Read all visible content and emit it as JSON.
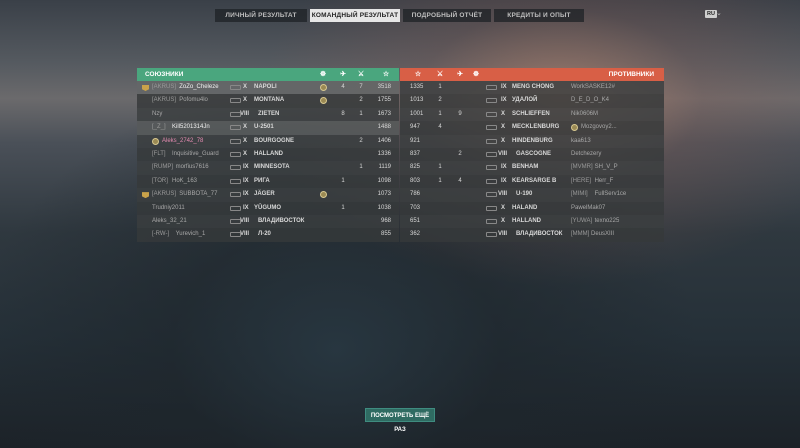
{
  "tabs": [
    "ЛИЧНЫЙ РЕЗУЛЬТАТ",
    "КОМАНДНЫЙ РЕЗУЛЬТАТ",
    "ПОДРОБНЫЙ ОТЧЁТ",
    "КРЕДИТЫ И ОПЫТ"
  ],
  "active_tab": "КОМАНДНЫЙ РЕЗУЛЬТАТ",
  "lang": "RU",
  "ally_title": "СОЮЗНИКИ",
  "enemy_title": "ПРОТИВНИКИ",
  "header_icons": {
    "ally": [
      "medal-icon",
      "planes-icon",
      "kills-icon",
      "score-star-icon"
    ],
    "enemy": [
      "score-star-icon",
      "kills-icon",
      "planes-icon",
      "medal-icon"
    ],
    "glyphs": {
      "medal-icon": "☸",
      "planes-icon": "✈",
      "kills-icon": "⚔",
      "score-star-icon": "☆"
    }
  },
  "allies": [
    {
      "clan": "[AKRUS]",
      "name": "ZoZo_Cheleze",
      "tier": "X",
      "ship": "NAPOLI",
      "medal": true,
      "planes": "4",
      "kills": "7",
      "score": "3518",
      "flag": true,
      "me": true
    },
    {
      "clan": "[AKRUS]",
      "name": "Pofomu4lo",
      "tier": "X",
      "ship": "MONTANA",
      "medal": true,
      "planes": "",
      "kills": "2",
      "score": "1755"
    },
    {
      "clan": "",
      "name": "Nzy",
      "tier": "VIII",
      "ship": "ZIETEN",
      "planes": "8",
      "kills": "1",
      "score": "1673"
    },
    {
      "clan": "[_Z_]",
      "name": "Kill5201314Jn",
      "tier": "X",
      "ship": "U-2501",
      "planes": "",
      "kills": "",
      "score": "1488",
      "sel": true,
      "white": true
    },
    {
      "clan": "",
      "name": "Aleks_2742_78",
      "tier": "X",
      "ship": "BOURGOGNE",
      "planes": "",
      "kills": "2",
      "score": "1406",
      "pink": true
    },
    {
      "clan": "[FLT]",
      "name": "Inquisitive_Guard",
      "tier": "X",
      "ship": "HALLAND",
      "planes": "",
      "kills": "",
      "score": "1336"
    },
    {
      "clan": "[RUMP]",
      "name": "morfius7616",
      "tier": "IX",
      "ship": "MINNESOTA",
      "planes": "",
      "kills": "1",
      "score": "1119"
    },
    {
      "clan": "[TOR]",
      "name": "HoK_163",
      "tier": "IX",
      "ship": "РИГА",
      "planes": "1",
      "kills": "",
      "score": "1098"
    },
    {
      "clan": "[AKRUS]",
      "name": "SUBBOTA_77",
      "tier": "IX",
      "ship": "JÄGER",
      "medal": true,
      "planes": "",
      "kills": "",
      "score": "1073",
      "flag": true
    },
    {
      "clan": "",
      "name": "Trudniy2011",
      "tier": "IX",
      "ship": "YŪGUMO",
      "planes": "1",
      "kills": "",
      "score": "1038"
    },
    {
      "clan": "",
      "name": "Aleks_32_21",
      "tier": "VIII",
      "ship": "ВЛАДИВОСТОК",
      "planes": "",
      "kills": "",
      "score": "968"
    },
    {
      "clan": "[-RW-]",
      "name": "Yurevich_1",
      "tier": "VIII",
      "ship": "Л-20",
      "planes": "",
      "kills": "",
      "score": "855"
    }
  ],
  "enemies": [
    {
      "score": "1335",
      "kills": "1",
      "planes": "",
      "tier": "IX",
      "ship": "MENG CHONG",
      "clan": "",
      "name": "WorkSASKE12#"
    },
    {
      "score": "1013",
      "kills": "2",
      "planes": "",
      "tier": "IX",
      "ship": "УДАЛОЙ",
      "clan": "",
      "name": "D_E_D_O_K4"
    },
    {
      "score": "1001",
      "kills": "1",
      "planes": "9",
      "tier": "X",
      "ship": "SCHLIEFFEN",
      "clan": "",
      "name": "Nik0606M"
    },
    {
      "score": "947",
      "kills": "4",
      "planes": "",
      "tier": "X",
      "ship": "MECKLENBURG",
      "clan": "",
      "name": "Mozgovoy2...",
      "medal": true
    },
    {
      "score": "921",
      "kills": "",
      "planes": "",
      "tier": "X",
      "ship": "HINDENBURG",
      "clan": "",
      "name": "kaa613"
    },
    {
      "score": "837",
      "kills": "",
      "planes": "2",
      "tier": "VIII",
      "ship": "GASCOGNE",
      "clan": "",
      "name": "Detchezery"
    },
    {
      "score": "825",
      "kills": "1",
      "planes": "",
      "tier": "IX",
      "ship": "BENHAM",
      "clan": "[MVMR]",
      "name": "SH_V_P"
    },
    {
      "score": "803",
      "kills": "1",
      "planes": "4",
      "tier": "IX",
      "ship": "KEARSARGE B",
      "clan": "[HERE]",
      "name": "Herr_F"
    },
    {
      "score": "786",
      "kills": "",
      "planes": "",
      "tier": "VIII",
      "ship": "U-190",
      "clan": "[MIMI]",
      "name": "FullServ1ce"
    },
    {
      "score": "703",
      "kills": "",
      "planes": "",
      "tier": "X",
      "ship": "HALAND",
      "clan": "",
      "name": "PawelMak07"
    },
    {
      "score": "651",
      "kills": "",
      "planes": "",
      "tier": "X",
      "ship": "HALLAND",
      "clan": "[YUWA]",
      "name": "texno225"
    },
    {
      "score": "362",
      "kills": "",
      "planes": "",
      "tier": "VIII",
      "ship": "ВЛАДИВОСТОК",
      "clan": "[MMM]",
      "name": "DeusXIII"
    }
  ],
  "watch_again": "ПОСМОТРЕТЬ ЕЩЁ РАЗ"
}
